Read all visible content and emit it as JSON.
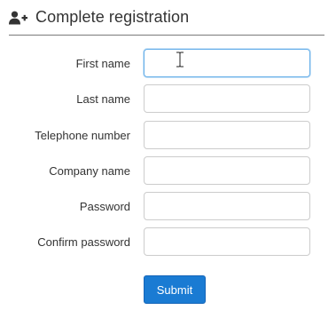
{
  "header": {
    "title": "Complete registration",
    "icon": "add-user-icon"
  },
  "form": {
    "fields": [
      {
        "label": "First name",
        "value": "",
        "focused": true
      },
      {
        "label": "Last name",
        "value": ""
      },
      {
        "label": "Telephone number",
        "value": ""
      },
      {
        "label": "Company name",
        "value": ""
      },
      {
        "label": "Password",
        "value": ""
      },
      {
        "label": "Confirm password",
        "value": ""
      }
    ],
    "submit_label": "Submit"
  },
  "colors": {
    "accent": "#1a7bd3",
    "focus_border": "#66afe9",
    "divider": "#7a7a7a"
  }
}
